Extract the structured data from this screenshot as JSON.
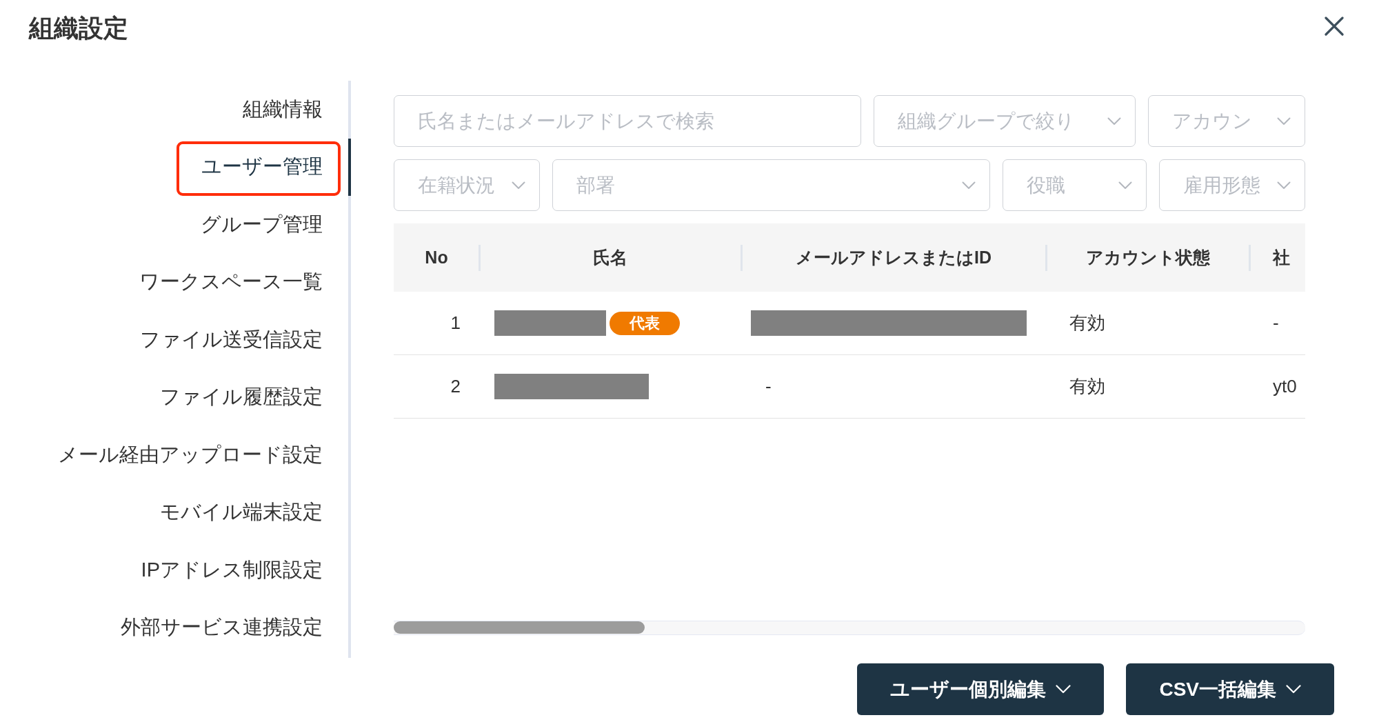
{
  "window": {
    "title": "組織設定"
  },
  "sidebar": {
    "items": [
      {
        "label": "組織情報",
        "selected": false,
        "highlighted": false
      },
      {
        "label": "ユーザー管理",
        "selected": true,
        "highlighted": true
      },
      {
        "label": "グループ管理",
        "selected": false,
        "highlighted": false
      },
      {
        "label": "ワークスペース一覧",
        "selected": false,
        "highlighted": false
      },
      {
        "label": "ファイル送受信設定",
        "selected": false,
        "highlighted": false
      },
      {
        "label": "ファイル履歴設定",
        "selected": false,
        "highlighted": false
      },
      {
        "label": "メール経由アップロード設定",
        "selected": false,
        "highlighted": false
      },
      {
        "label": "モバイル端末設定",
        "selected": false,
        "highlighted": false
      },
      {
        "label": "IPアドレス制限設定",
        "selected": false,
        "highlighted": false
      },
      {
        "label": "外部サービス連携設定",
        "selected": false,
        "highlighted": false
      }
    ]
  },
  "filter_rows": [
    [
      {
        "kind": "search",
        "placeholder": "氏名またはメールアドレスで検索"
      },
      {
        "kind": "dropdown",
        "placeholder": "組織グループで絞り"
      },
      {
        "kind": "dropdown",
        "placeholder": "アカウン"
      }
    ],
    [
      {
        "kind": "dropdown",
        "placeholder": "在籍状況"
      },
      {
        "kind": "dropdown",
        "placeholder": "部署"
      },
      {
        "kind": "dropdown",
        "placeholder": "役職"
      },
      {
        "kind": "dropdown",
        "placeholder": "雇用形態"
      }
    ]
  ],
  "table": {
    "columns": [
      "No",
      "氏名",
      "メールアドレスまたはID",
      "アカウント状態",
      "社"
    ],
    "rows": [
      {
        "cells": [
          {
            "kind": "number",
            "text": "1"
          },
          {
            "kind": "redacted",
            "badge": "代表"
          },
          {
            "kind": "redacted"
          },
          {
            "kind": "text",
            "text": "有効"
          },
          {
            "kind": "text",
            "text": "-"
          }
        ]
      },
      {
        "cells": [
          {
            "kind": "number",
            "text": "2"
          },
          {
            "kind": "redacted"
          },
          {
            "kind": "text",
            "text": "-"
          },
          {
            "kind": "text",
            "text": "有効"
          },
          {
            "kind": "text",
            "text": "yt0"
          }
        ]
      }
    ]
  },
  "actions": [
    {
      "label": "ユーザー個別編集"
    },
    {
      "label": "CSV一括編集"
    }
  ]
}
